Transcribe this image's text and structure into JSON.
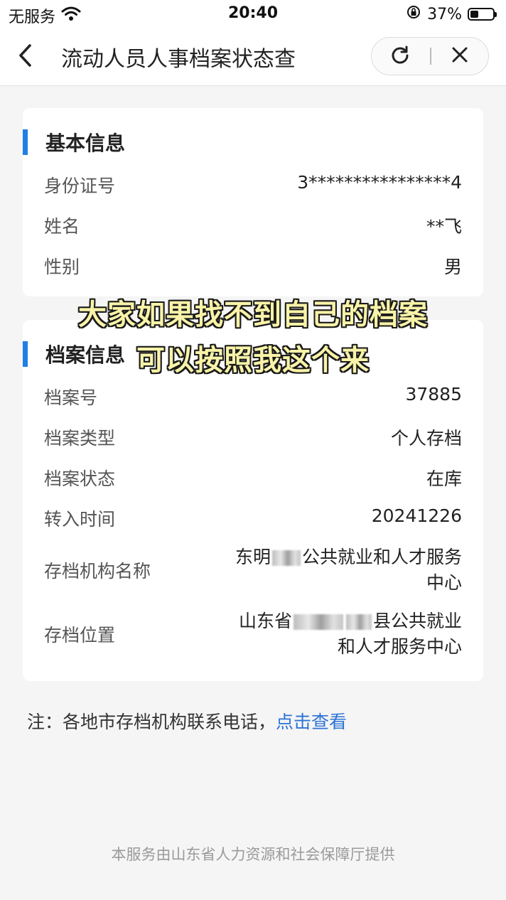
{
  "status_bar": {
    "carrier": "无服务",
    "time": "20:40",
    "battery_percent": "37%",
    "battery_level": 0.37,
    "icons": [
      "wifi-icon",
      "rotation-lock-icon",
      "battery-icon"
    ]
  },
  "nav": {
    "title": "流动人员人事档案状态查",
    "icons": [
      "back-chevron-icon",
      "refresh-icon",
      "close-icon"
    ]
  },
  "basic_info": {
    "title": "基本信息",
    "rows": [
      {
        "label": "身份证号",
        "value": "3****************4"
      },
      {
        "label": "姓名",
        "value": "**飞"
      },
      {
        "label": "性别",
        "value": "男"
      }
    ]
  },
  "archive_info": {
    "title": "档案信息",
    "rows": [
      {
        "label": "档案号",
        "value": "37885"
      },
      {
        "label": "档案类型",
        "value": "个人存档"
      },
      {
        "label": "档案状态",
        "value": "在库"
      },
      {
        "label": "转入时间",
        "value": "20241226"
      }
    ],
    "institution": {
      "label": "存档机构名称",
      "value_prefix": "东明",
      "value_suffix": "公共就业和人才服务中心"
    },
    "location": {
      "label": "存档位置",
      "value_prefix": "山东省",
      "value_suffix": "县公共就业和人才服务中心"
    }
  },
  "overlay": {
    "line1": "大家如果找不到自己的档案",
    "line2": "可以按照我这个来"
  },
  "note": {
    "text": "注：各地市存档机构联系电话，",
    "link": "点击查看"
  },
  "footer": "本服务由山东省人力资源和社会保障厅提供",
  "colors": {
    "accent": "#1e7fe6",
    "link": "#2b73d6",
    "caption_fill": "#f8f3a8"
  }
}
